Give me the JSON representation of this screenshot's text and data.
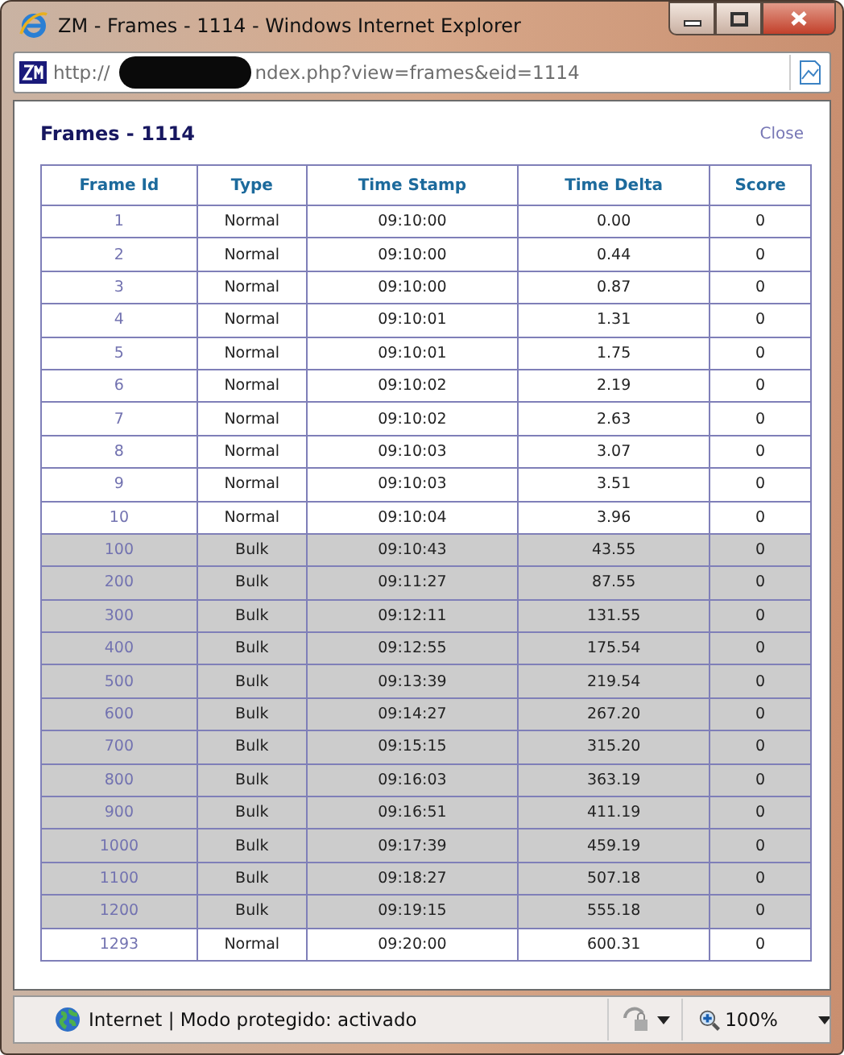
{
  "window": {
    "title": "ZM - Frames - 1114 - Windows Internet Explorer"
  },
  "address_bar": {
    "url_start": "http://",
    "url_end": "ndex.php?view=frames&eid=1114"
  },
  "page": {
    "heading": "Frames - 1114",
    "close_link": "Close"
  },
  "table": {
    "columns": [
      "Frame Id",
      "Type",
      "Time Stamp",
      "Time Delta",
      "Score"
    ],
    "rows": [
      {
        "kind": "normal",
        "cells": [
          "1",
          "Normal",
          "09:10:00",
          "0.00",
          "0"
        ]
      },
      {
        "kind": "normal",
        "cells": [
          "2",
          "Normal",
          "09:10:00",
          "0.44",
          "0"
        ]
      },
      {
        "kind": "normal",
        "cells": [
          "3",
          "Normal",
          "09:10:00",
          "0.87",
          "0"
        ]
      },
      {
        "kind": "normal",
        "cells": [
          "4",
          "Normal",
          "09:10:01",
          "1.31",
          "0"
        ]
      },
      {
        "kind": "normal",
        "cells": [
          "5",
          "Normal",
          "09:10:01",
          "1.75",
          "0"
        ]
      },
      {
        "kind": "normal",
        "cells": [
          "6",
          "Normal",
          "09:10:02",
          "2.19",
          "0"
        ]
      },
      {
        "kind": "normal",
        "cells": [
          "7",
          "Normal",
          "09:10:02",
          "2.63",
          "0"
        ]
      },
      {
        "kind": "normal",
        "cells": [
          "8",
          "Normal",
          "09:10:03",
          "3.07",
          "0"
        ]
      },
      {
        "kind": "normal",
        "cells": [
          "9",
          "Normal",
          "09:10:03",
          "3.51",
          "0"
        ]
      },
      {
        "kind": "normal",
        "cells": [
          "10",
          "Normal",
          "09:10:04",
          "3.96",
          "0"
        ]
      },
      {
        "kind": "bulk",
        "cells": [
          "100",
          "Bulk",
          "09:10:43",
          "43.55",
          "0"
        ]
      },
      {
        "kind": "bulk",
        "cells": [
          "200",
          "Bulk",
          "09:11:27",
          "87.55",
          "0"
        ]
      },
      {
        "kind": "bulk",
        "cells": [
          "300",
          "Bulk",
          "09:12:11",
          "131.55",
          "0"
        ]
      },
      {
        "kind": "bulk",
        "cells": [
          "400",
          "Bulk",
          "09:12:55",
          "175.54",
          "0"
        ]
      },
      {
        "kind": "bulk",
        "cells": [
          "500",
          "Bulk",
          "09:13:39",
          "219.54",
          "0"
        ]
      },
      {
        "kind": "bulk",
        "cells": [
          "600",
          "Bulk",
          "09:14:27",
          "267.20",
          "0"
        ]
      },
      {
        "kind": "bulk",
        "cells": [
          "700",
          "Bulk",
          "09:15:15",
          "315.20",
          "0"
        ]
      },
      {
        "kind": "bulk",
        "cells": [
          "800",
          "Bulk",
          "09:16:03",
          "363.19",
          "0"
        ]
      },
      {
        "kind": "bulk",
        "cells": [
          "900",
          "Bulk",
          "09:16:51",
          "411.19",
          "0"
        ]
      },
      {
        "kind": "bulk",
        "cells": [
          "1000",
          "Bulk",
          "09:17:39",
          "459.19",
          "0"
        ]
      },
      {
        "kind": "bulk",
        "cells": [
          "1100",
          "Bulk",
          "09:18:27",
          "507.18",
          "0"
        ]
      },
      {
        "kind": "bulk",
        "cells": [
          "1200",
          "Bulk",
          "09:19:15",
          "555.18",
          "0"
        ]
      },
      {
        "kind": "normal",
        "cells": [
          "1293",
          "Normal",
          "09:20:00",
          "600.31",
          "0"
        ]
      }
    ]
  },
  "status_bar": {
    "zone": "Internet | Modo protegido: activado",
    "zoom": "100%"
  }
}
